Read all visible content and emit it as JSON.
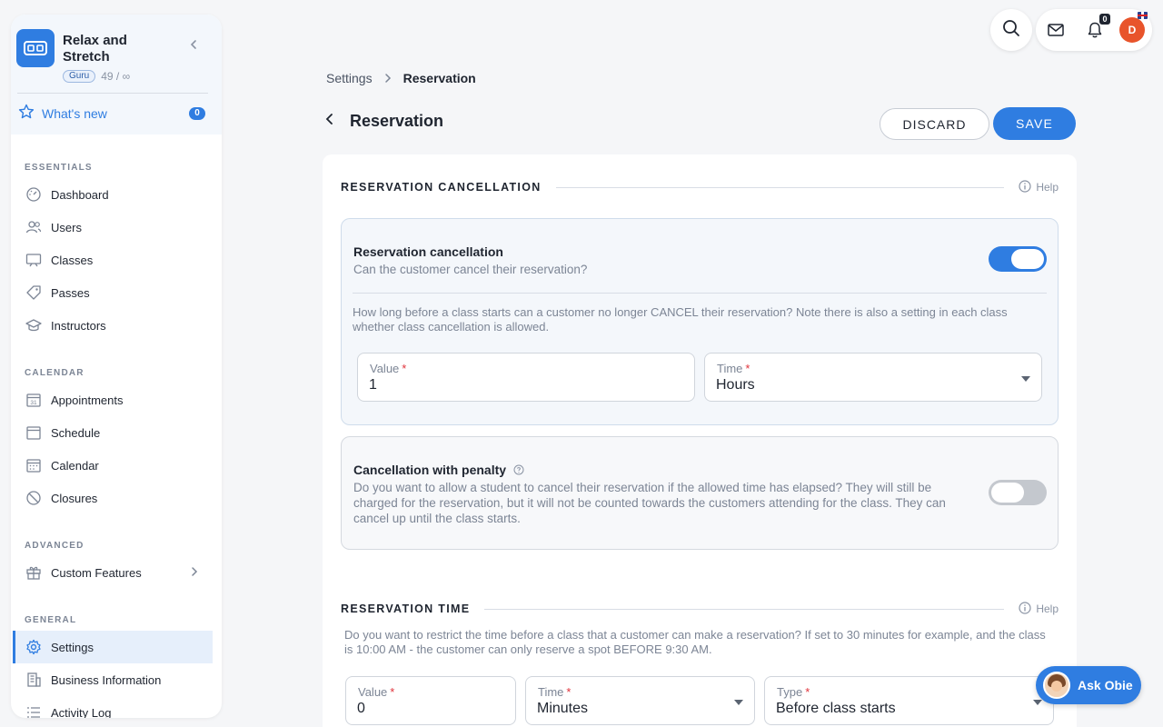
{
  "sidebar": {
    "business_name": "Relax and Stretch",
    "plan_badge": "Guru",
    "plan_count": "49 / ∞",
    "whats_new": {
      "label": "What's new",
      "count": "0"
    },
    "sections": [
      {
        "label": "ESSENTIALS",
        "items": [
          {
            "label": "Dashboard",
            "icon": "dashboard-icon"
          },
          {
            "label": "Users",
            "icon": "users-icon"
          },
          {
            "label": "Classes",
            "icon": "classes-icon"
          },
          {
            "label": "Passes",
            "icon": "passes-icon"
          },
          {
            "label": "Instructors",
            "icon": "instructors-icon"
          }
        ]
      },
      {
        "label": "CALENDAR",
        "items": [
          {
            "label": "Appointments",
            "icon": "appointments-icon"
          },
          {
            "label": "Schedule",
            "icon": "schedule-icon"
          },
          {
            "label": "Calendar",
            "icon": "calendar-icon"
          },
          {
            "label": "Closures",
            "icon": "closures-icon"
          }
        ]
      },
      {
        "label": "ADVANCED",
        "items": [
          {
            "label": "Custom Features",
            "icon": "custom-features-icon"
          }
        ]
      },
      {
        "label": "GENERAL",
        "items": [
          {
            "label": "Settings",
            "icon": "settings-icon",
            "active": true
          },
          {
            "label": "Business Information",
            "icon": "business-information-icon"
          },
          {
            "label": "Activity Log",
            "icon": "activity-log-icon"
          }
        ]
      }
    ]
  },
  "topbar": {
    "notification_count": "0",
    "avatar_initial": "D"
  },
  "breadcrumb": {
    "root": "Settings",
    "current": "Reservation"
  },
  "page": {
    "title": "Reservation",
    "discard_label": "DISCARD",
    "save_label": "SAVE"
  },
  "cancellation_section": {
    "title": "RESERVATION CANCELLATION",
    "help": "Help",
    "panel": {
      "title": "Reservation cancellation",
      "subtitle": "Can the customer cancel their reservation?",
      "enabled": true,
      "description": "How long before a class starts can a customer no longer CANCEL their reservation? Note there is also a setting in each class whether class cancellation is allowed.",
      "value_label": "Value",
      "value": "1",
      "time_label": "Time",
      "time_value": "Hours"
    },
    "penalty_panel": {
      "title": "Cancellation with penalty",
      "description": "Do you want to allow a student to cancel their reservation if the allowed time has elapsed? They will still be charged for the reservation, but it will not be counted towards the customers attending for the class. They can cancel up until the class starts.",
      "enabled": false
    }
  },
  "time_section": {
    "title": "RESERVATION TIME",
    "help": "Help",
    "description": "Do you want to restrict the time before a class that a customer can make a reservation? If set to 30 minutes for example, and the class is 10:00 AM - the customer can only reserve a spot BEFORE 9:30 AM.",
    "value_label": "Value",
    "value": "0",
    "time_label": "Time",
    "time_value": "Minutes",
    "type_label": "Type",
    "type_value": "Before class starts"
  },
  "assistant": {
    "label": "Ask Obie"
  },
  "colors": {
    "accent": "#2f7de1",
    "avatar": "#e8542b",
    "required": "#e0333b"
  }
}
